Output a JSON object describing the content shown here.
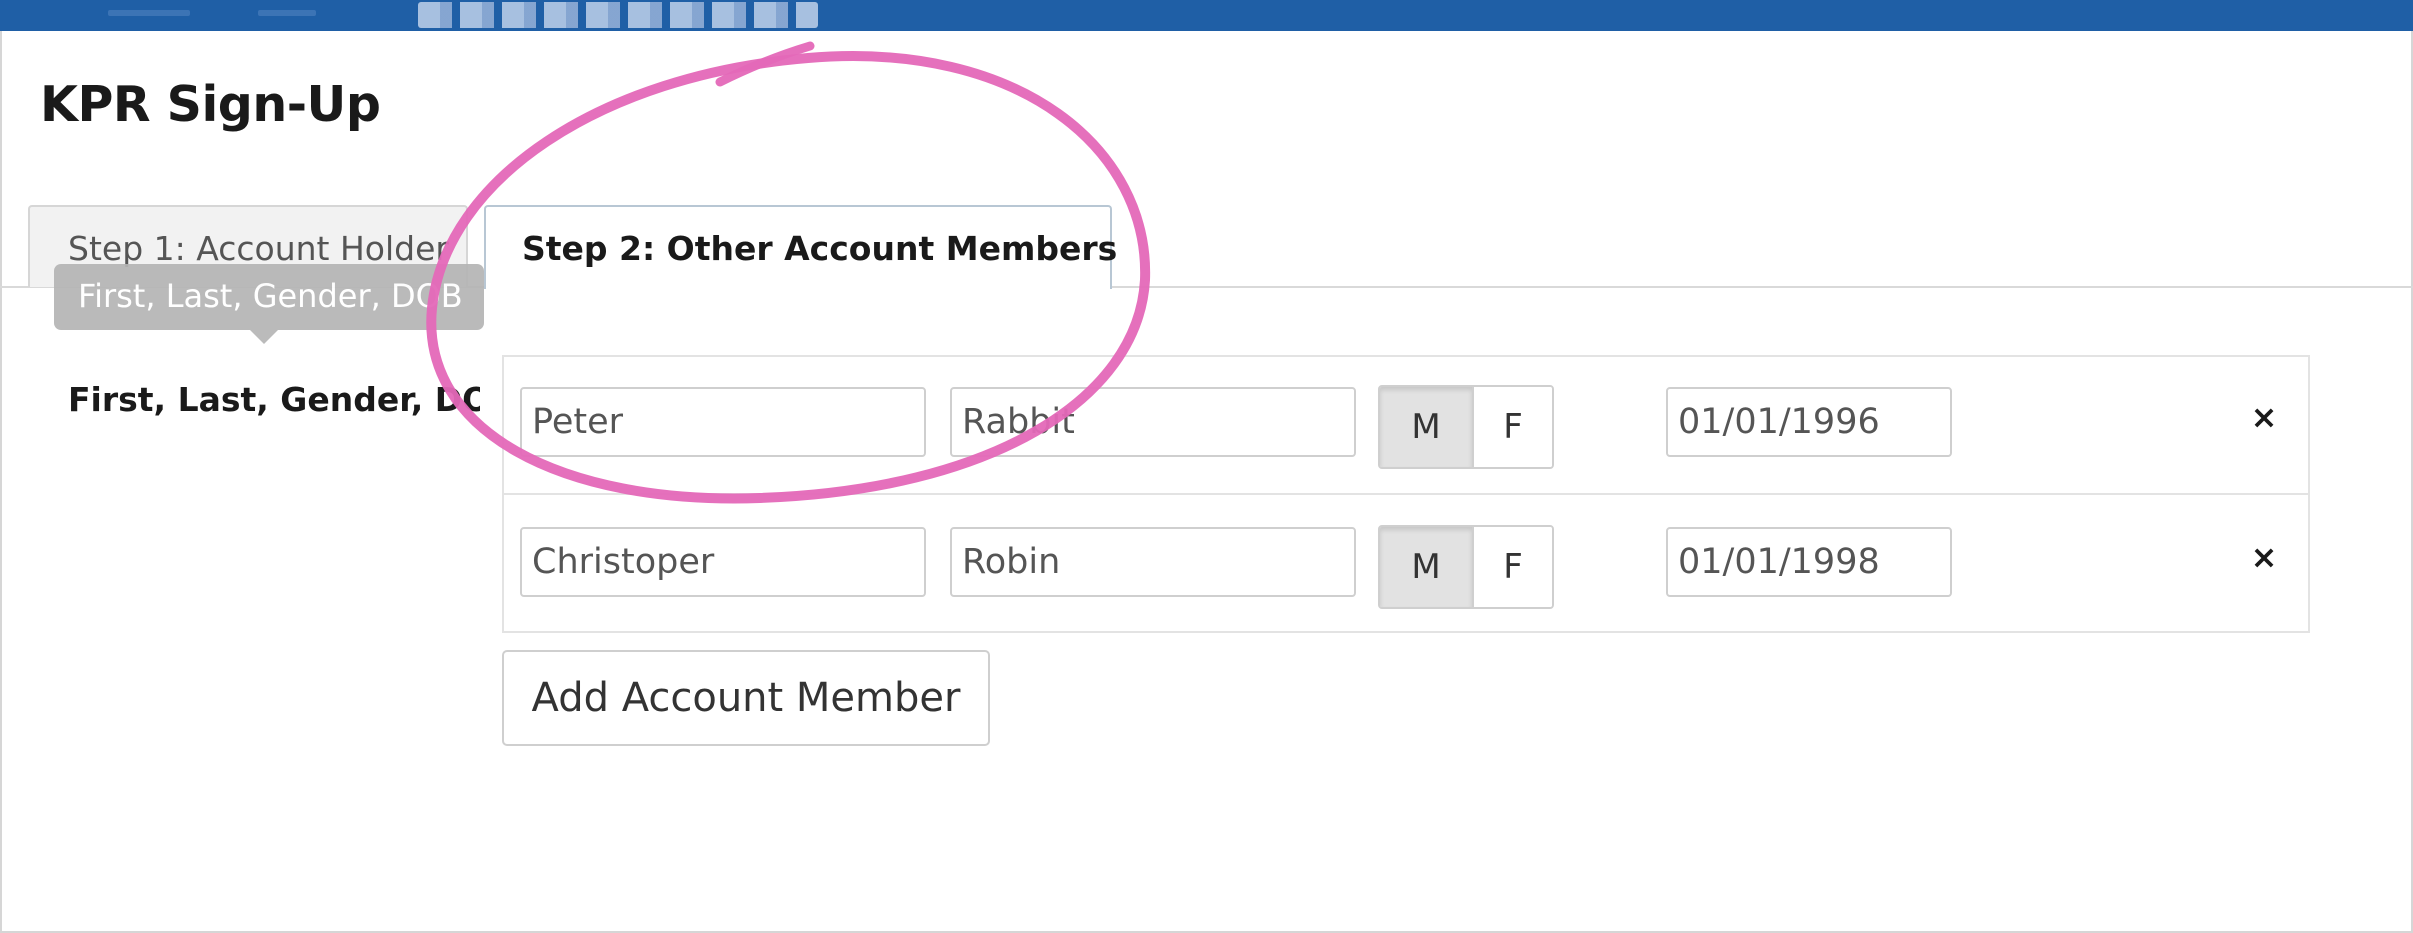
{
  "header": {
    "page_title": "KPR Sign-Up"
  },
  "tabs": [
    {
      "label": "Step 1: Account Holder",
      "active": false
    },
    {
      "label": "Step 2: Other Account Members",
      "active": true
    }
  ],
  "tooltip": {
    "text": "First, Last, Gender, DOB"
  },
  "form": {
    "fields_label": "First, Last, Gender, DOB",
    "members": [
      {
        "first": "Peter",
        "last": "Rabbit",
        "gender_options": [
          "M",
          "F"
        ],
        "gender_selected": "M",
        "dob": "01/01/1996"
      },
      {
        "first": "Christoper",
        "last": "Robin",
        "gender_options": [
          "M",
          "F"
        ],
        "gender_selected": "M",
        "dob": "01/01/1998"
      }
    ],
    "remove_label": "×",
    "add_member_label": "Add Account Member"
  },
  "colors": {
    "topbar": "#1f5fa6",
    "annotation_circle": "#e468b8",
    "selected_gender_bg": "#e2e2e2"
  }
}
